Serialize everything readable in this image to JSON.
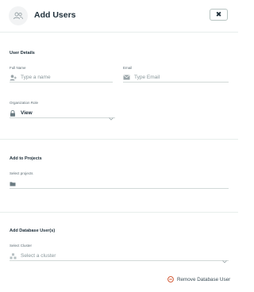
{
  "header": {
    "title": "Add Users",
    "icon": "users-icon",
    "close_label": "✖"
  },
  "user_details": {
    "section_title": "User Details",
    "full_name": {
      "label": "Full Name",
      "placeholder": "Type a name",
      "icon": "user-add-icon"
    },
    "email": {
      "label": "Email",
      "placeholder": "Type Email",
      "icon": "envelope-icon"
    },
    "org_role": {
      "label": "Organization Role",
      "value": "View",
      "icon": "lock-icon"
    }
  },
  "projects": {
    "section_title": "Add to Projects",
    "select_label": "Select projects",
    "icon": "folder-icon"
  },
  "db_user": {
    "section_title": "Add Database User(s)",
    "cluster_label": "Select Cluster",
    "cluster_placeholder": "Select a cluster",
    "icon": "cluster-icon",
    "remove_label": "Remove Database User"
  },
  "colors": {
    "accent_red": "#cf4a22",
    "text": "#21313c",
    "muted": "#89979b"
  }
}
